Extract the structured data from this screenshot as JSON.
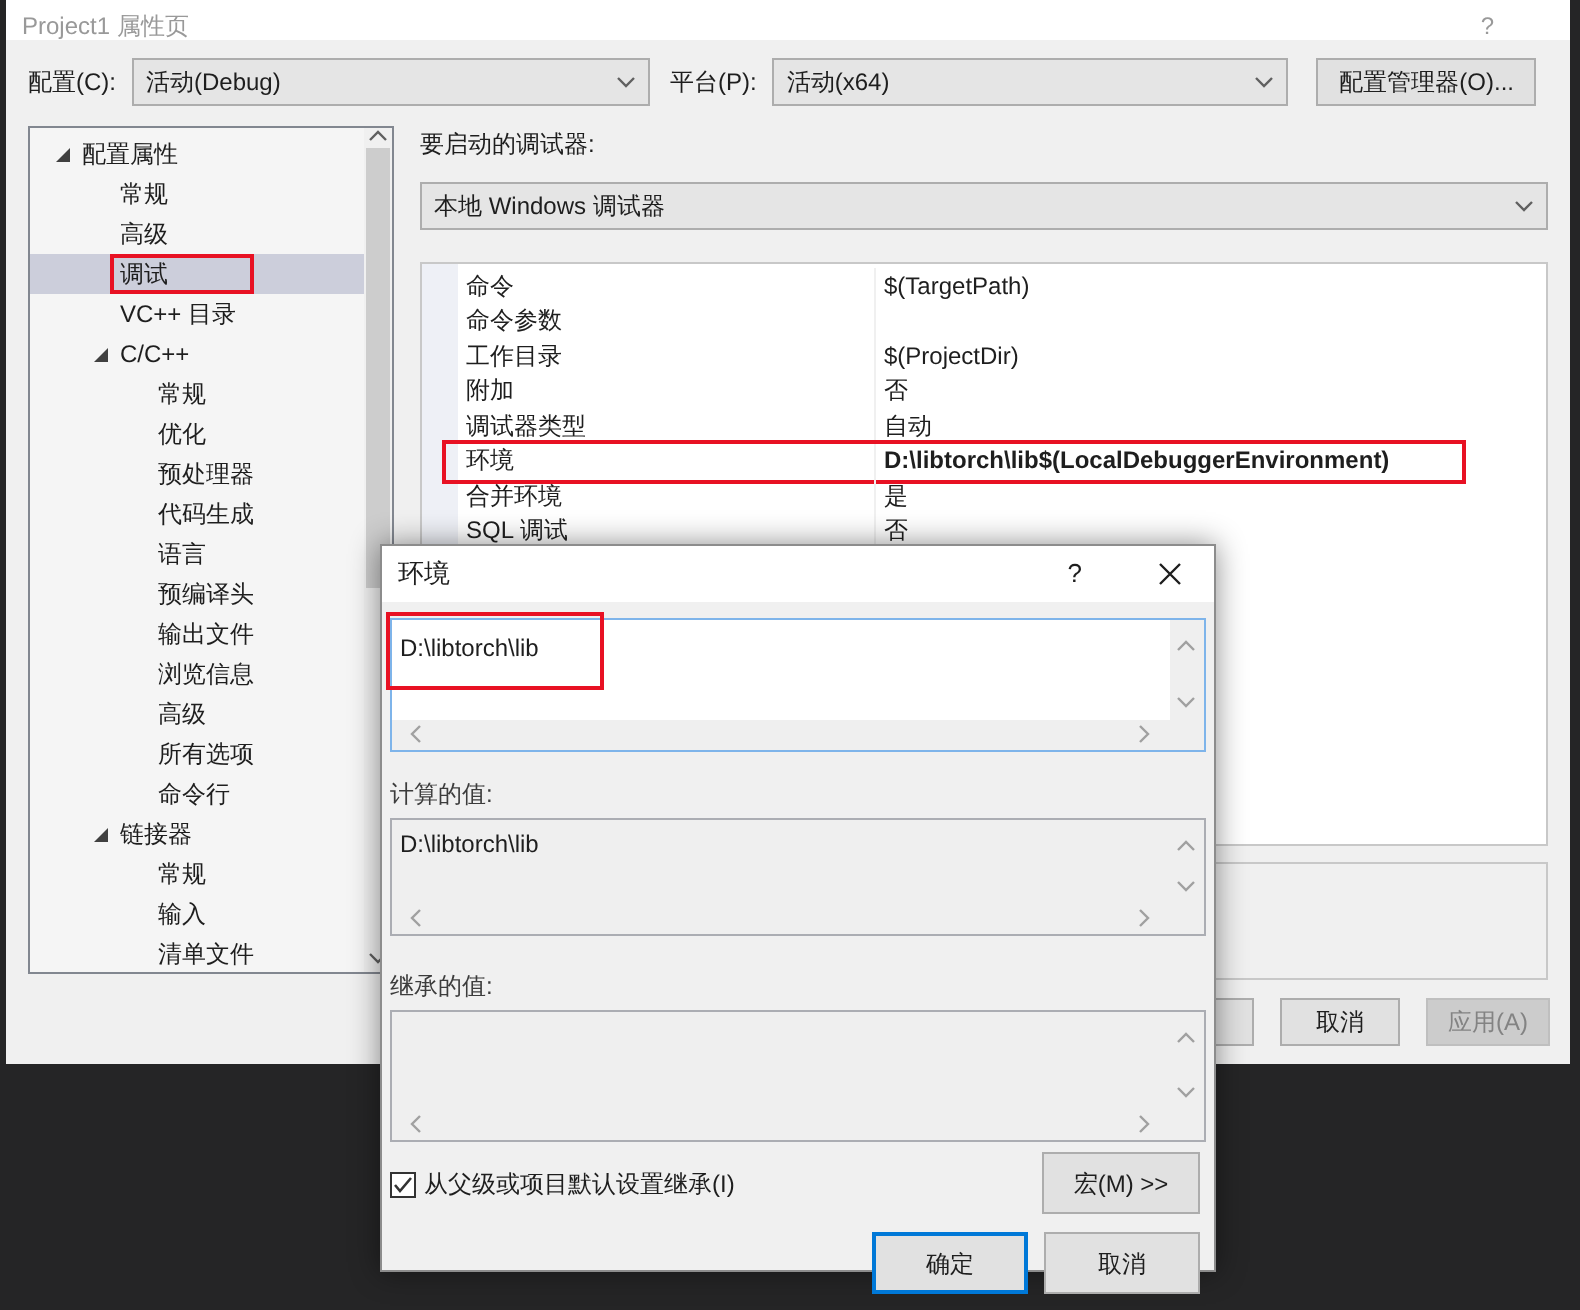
{
  "window": {
    "title": "Project1 属性页",
    "help": "?"
  },
  "toolbar": {
    "config_label": "配置(C):",
    "config_value": "活动(Debug)",
    "platform_label": "平台(P):",
    "platform_value": "活动(x64)",
    "manager_button": "配置管理器(O)..."
  },
  "tree": [
    {
      "label": "配置属性",
      "expanded": true,
      "selected": false,
      "highlighted": false,
      "children": [
        {
          "label": "常规",
          "selected": false,
          "highlighted": false
        },
        {
          "label": "高级",
          "selected": false,
          "highlighted": false
        },
        {
          "label": "调试",
          "selected": true,
          "highlighted": true
        },
        {
          "label": "VC++ 目录",
          "selected": false,
          "highlighted": false
        },
        {
          "label": "C/C++",
          "expanded": true,
          "selected": false,
          "highlighted": false,
          "children": [
            {
              "label": "常规",
              "selected": false,
              "highlighted": false
            },
            {
              "label": "优化",
              "selected": false,
              "highlighted": false
            },
            {
              "label": "预处理器",
              "selected": false,
              "highlighted": false
            },
            {
              "label": "代码生成",
              "selected": false,
              "highlighted": false
            },
            {
              "label": "语言",
              "selected": false,
              "highlighted": false
            },
            {
              "label": "预编译头",
              "selected": false,
              "highlighted": false
            },
            {
              "label": "输出文件",
              "selected": false,
              "highlighted": false
            },
            {
              "label": "浏览信息",
              "selected": false,
              "highlighted": false
            },
            {
              "label": "高级",
              "selected": false,
              "highlighted": false
            },
            {
              "label": "所有选项",
              "selected": false,
              "highlighted": false
            },
            {
              "label": "命令行",
              "selected": false,
              "highlighted": false
            }
          ]
        },
        {
          "label": "链接器",
          "expanded": true,
          "selected": false,
          "highlighted": false,
          "children": [
            {
              "label": "常规",
              "selected": false,
              "highlighted": false
            },
            {
              "label": "输入",
              "selected": false,
              "highlighted": false
            },
            {
              "label": "清单文件",
              "selected": false,
              "highlighted": false
            }
          ]
        }
      ]
    }
  ],
  "debugger": {
    "label": "要启动的调试器:",
    "value": "本地 Windows 调试器"
  },
  "properties": [
    {
      "name": "命令",
      "value": "$(TargetPath)",
      "bold": false,
      "highlighted": false
    },
    {
      "name": "命令参数",
      "bold": false,
      "highlighted": false
    },
    {
      "name": "工作目录",
      "value": "$(ProjectDir)",
      "bold": false,
      "highlighted": false
    },
    {
      "name": "附加",
      "value": "否",
      "bold": false,
      "highlighted": false
    },
    {
      "name": "调试器类型",
      "value": "自动",
      "bold": false,
      "highlighted": false
    },
    {
      "name": "环境",
      "value": "D:\\libtorch\\lib$(LocalDebuggerEnvironment)",
      "bold": true,
      "highlighted": true
    },
    {
      "name": "合并环境",
      "value": "是",
      "bold": false,
      "highlighted": false
    },
    {
      "name": "SQL 调试",
      "value": "否",
      "bold": false,
      "highlighted": false
    }
  ],
  "buttons": [
    {
      "label": "取消",
      "disabled": false
    },
    {
      "label": "应用(A)",
      "disabled": true
    }
  ],
  "dialog": {
    "title": "环境",
    "help": "?",
    "value": "D:\\libtorch\\lib",
    "value_highlighted": true,
    "evaluated_label": "计算的值:",
    "evaluated_value": "D:\\libtorch\\lib",
    "inherited_label": "继承的值:",
    "inherit_checkbox": {
      "label": "从父级或项目默认设置继承(I)",
      "checked": true
    },
    "macros_button": "宏(M) >>",
    "buttons": [
      {
        "label": "确定",
        "default": true
      },
      {
        "label": "取消",
        "default": false
      }
    ]
  }
}
